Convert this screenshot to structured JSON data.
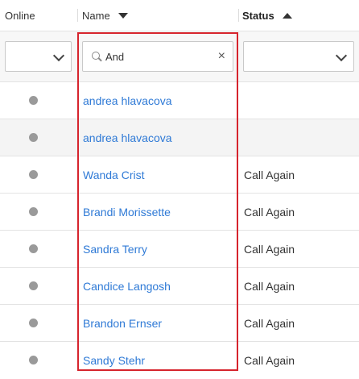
{
  "header": {
    "online_label": "Online",
    "name_label": "Name",
    "status_label": "Status"
  },
  "filters": {
    "online_value": "",
    "name_search_value": "And",
    "status_value": ""
  },
  "icons": {
    "sort_name": "sort-descending-icon",
    "sort_status": "sort-ascending-icon",
    "search": "search-icon",
    "clear": "close-icon",
    "dropdown": "chevron-down-icon",
    "online_indicator": "status-dot-icon"
  },
  "colors": {
    "link": "#2f7ad6",
    "highlight": "#d6242d",
    "offline_dot": "#9a9a9a"
  },
  "rows": [
    {
      "name": "andrea hlavacova",
      "status": ""
    },
    {
      "name": "andrea hlavacova",
      "status": ""
    },
    {
      "name": "Wanda Crist",
      "status": "Call Again"
    },
    {
      "name": "Brandi Morissette",
      "status": "Call Again"
    },
    {
      "name": "Sandra Terry",
      "status": "Call Again"
    },
    {
      "name": "Candice Langosh",
      "status": "Call Again"
    },
    {
      "name": "Brandon Ernser",
      "status": "Call Again"
    },
    {
      "name": "Sandy Stehr",
      "status": "Call Again"
    }
  ]
}
